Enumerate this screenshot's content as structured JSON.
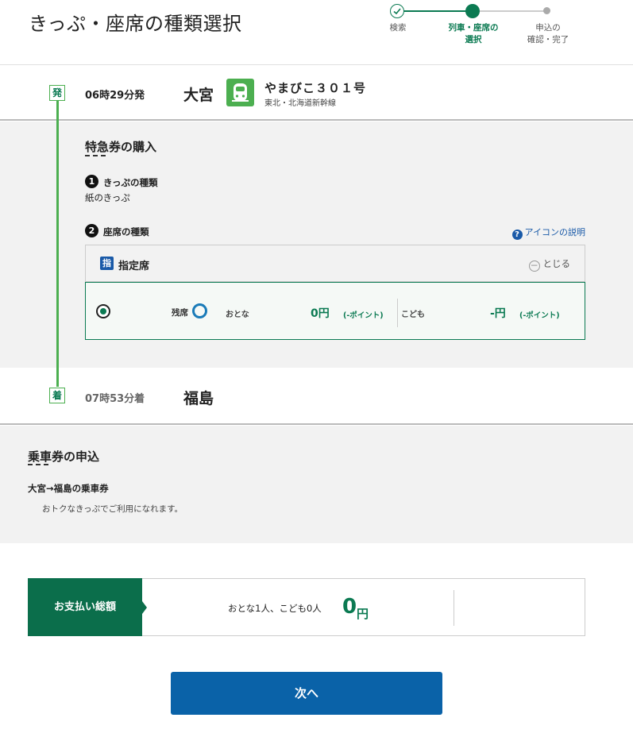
{
  "page": {
    "title": "きっぷ・座席の種類選択"
  },
  "stepper": {
    "steps": [
      {
        "label": "検索",
        "state": "done"
      },
      {
        "label": "列車・座席の\n選択",
        "state": "current"
      },
      {
        "label": "申込の\n確認・完了",
        "state": "todo"
      }
    ]
  },
  "departure": {
    "badge": "発",
    "time": "06時29分発",
    "station": "大宮",
    "train_name": "やまびこ３０１号",
    "train_line": "東北・北海道新幹線"
  },
  "express": {
    "title": "特急券の購入",
    "ticket_type": {
      "number": "1",
      "heading": "きっぷの種類",
      "value": "紙のきっぷ"
    },
    "seat_type": {
      "number": "2",
      "heading": "座席の種類"
    },
    "help_link": "アイコンの説明",
    "seat": {
      "icon_char": "指",
      "label": "指定席",
      "close_label": "とじる",
      "availability_label": "残席",
      "adult_label": "おとな",
      "adult_price": "0円",
      "adult_points": "(-ポイント)",
      "child_label": "こども",
      "child_price": "-円",
      "child_points": "(-ポイント)"
    }
  },
  "arrival": {
    "badge": "着",
    "time": "07時53分着",
    "station": "福島"
  },
  "ride_ticket": {
    "title": "乗車券の申込",
    "route": "大宮→福島の乗車券",
    "note": "おトクなきっぷでご利用になれます。"
  },
  "total": {
    "label": "お支払い総額",
    "count": "おとな1人、こども0人",
    "amount": "0",
    "unit": "円"
  },
  "next_button": "次へ",
  "colors": {
    "primary_green": "#0b7a52",
    "primary_blue": "#0a62a8",
    "timeline_green": "#4caf50"
  }
}
